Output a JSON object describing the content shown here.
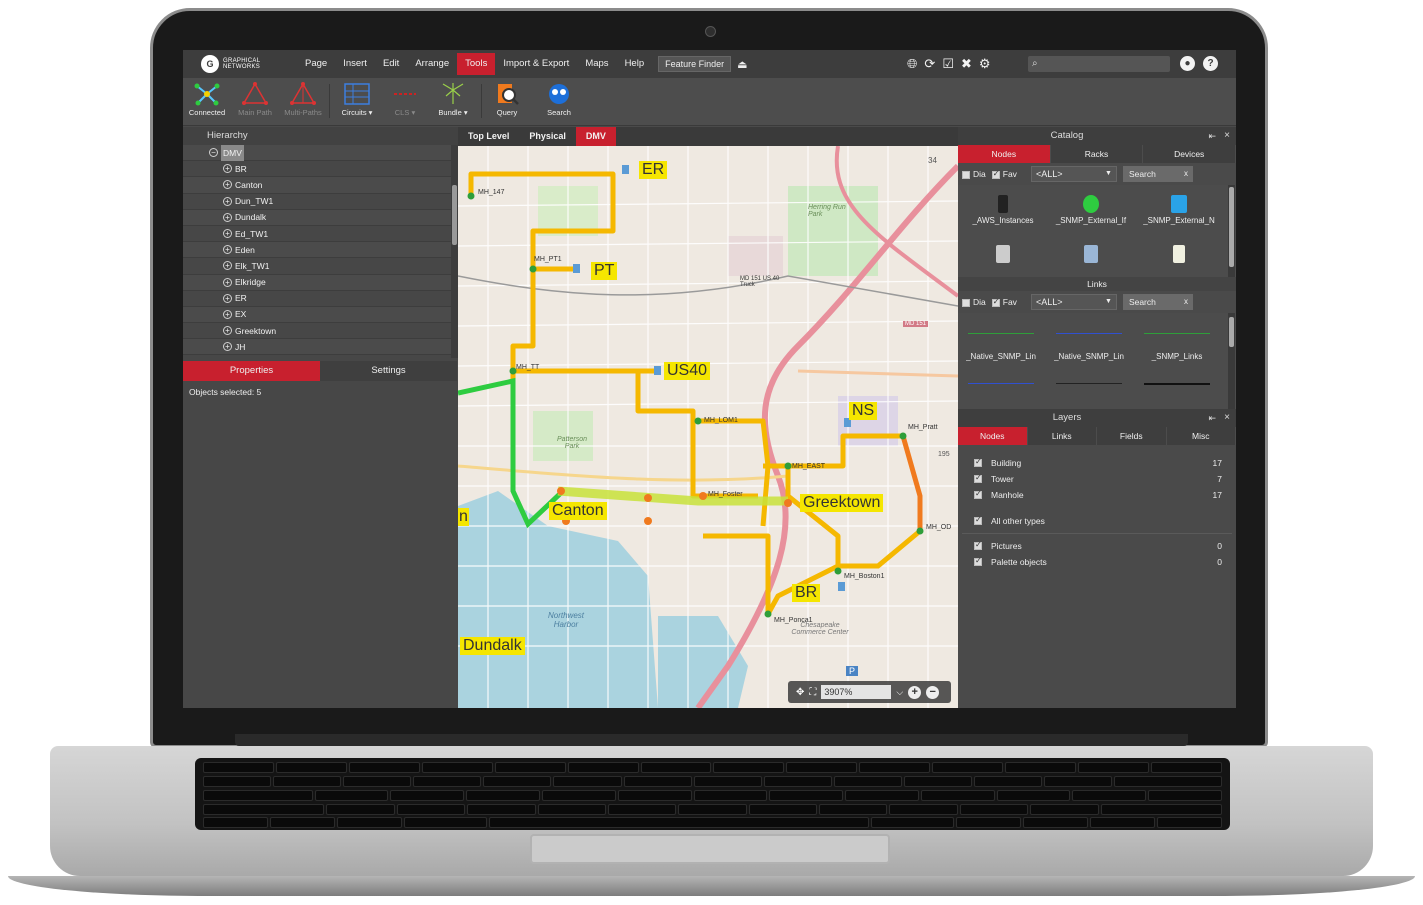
{
  "menu": {
    "logo_mark": "G",
    "logo_text": "GRAPHICAL NETWORKS",
    "items": [
      "Page",
      "Insert",
      "Edit",
      "Arrange",
      "Tools",
      "Import & Export",
      "Maps",
      "Help"
    ],
    "active_item": "Tools",
    "feature_finder": "Feature Finder",
    "search_icon": "⌕"
  },
  "toolbar": {
    "tools": [
      {
        "label": "Connected",
        "icon": "connected-icon",
        "enabled": true
      },
      {
        "label": "Main Path",
        "icon": "main-path-icon",
        "enabled": false
      },
      {
        "label": "Multi-Paths",
        "icon": "multi-paths-icon",
        "enabled": false
      },
      {
        "label": "Circuits ▾",
        "icon": "circuits-icon",
        "enabled": true
      },
      {
        "label": "CLS ▾",
        "icon": "cls-icon",
        "enabled": false
      },
      {
        "label": "Bundle ▾",
        "icon": "bundle-icon",
        "enabled": true
      },
      {
        "label": "Query",
        "icon": "query-icon",
        "enabled": true
      },
      {
        "label": "Search",
        "icon": "search-network-icon",
        "enabled": true
      }
    ]
  },
  "hierarchy": {
    "title": "Hierarchy",
    "root": "DMV",
    "items": [
      "BR",
      "Canton",
      "Dun_TW1",
      "Dundalk",
      "Ed_TW1",
      "Eden",
      "Elk_TW1",
      "Elkridge",
      "ER",
      "EX",
      "Greektown",
      "JH"
    ]
  },
  "properties": {
    "tabs": [
      "Properties",
      "Settings"
    ],
    "status": "Objects selected: 5"
  },
  "map": {
    "tabs": [
      "Top Level",
      "Physical",
      "DMV"
    ],
    "active_tab": "DMV",
    "zoom": "3907%",
    "labels": {
      "ER": "ER",
      "PT": "PT",
      "US40": "US40",
      "NS": "NS",
      "Canton": "Canton",
      "Greektown": "Greektown",
      "BR": "BR",
      "Dundalk": "Dundalk",
      "edge_n": "n"
    },
    "node_labels": {
      "mh147": "MH_147",
      "mhpt1": "MH_PT1",
      "mhtt": "MH_TT",
      "mhlom": "MH_LOM1",
      "mheast": "MH_EAST",
      "mhfoster": "MH_Foster",
      "mhboston": "MH_Boston1",
      "mhponca": "MH_Ponca1",
      "mhpratt": "MH_Pratt",
      "mhod": "MH_OD"
    },
    "street_labels": {
      "herring": "Herring Run Park",
      "md151": "MD 151",
      "md151b": "MD 151 US 40 Truck",
      "harbor": "Northwest Harbor",
      "chesapeake": "Chesapeake Commerce Center",
      "patterson": "Patterson Park",
      "n34": "34",
      "n195": "195",
      "p": "P"
    },
    "colors": {
      "route": "#f5b800",
      "route_orange": "#f07a1e",
      "route_green": "#2ecc40",
      "highlight": "#c8e23a",
      "water": "#aad3df"
    }
  },
  "catalog": {
    "title": "Catalog",
    "tabs": [
      "Nodes",
      "Racks",
      "Devices"
    ],
    "active_tab": "Nodes",
    "filter": {
      "dia": "Dia",
      "fav": "Fav",
      "select": "<ALL>",
      "search": "Search",
      "x": "x"
    },
    "nodes": [
      "_AWS_Instances",
      "_SNMP_External_If",
      "_SNMP_External_N",
      "",
      "",
      ""
    ],
    "links_title": "Links",
    "link_filter": {
      "dia": "Dia",
      "fav": "Fav",
      "select": "<ALL>",
      "search": "Search",
      "x": "x"
    },
    "links": [
      "_Native_SNMP_Lin",
      "_Native_SNMP_Lin",
      "_SNMP_Links"
    ]
  },
  "layers": {
    "title": "Layers",
    "tabs": [
      "Nodes",
      "Links",
      "Fields",
      "Misc"
    ],
    "active_tab": "Nodes",
    "rows": [
      {
        "label": "Building",
        "count": "17"
      },
      {
        "label": "Tower",
        "count": "7"
      },
      {
        "label": "Manhole",
        "count": "17"
      }
    ],
    "all_other": "All other types",
    "extra": [
      {
        "label": "Pictures",
        "count": "0"
      },
      {
        "label": "Palette objects",
        "count": "0"
      }
    ]
  }
}
